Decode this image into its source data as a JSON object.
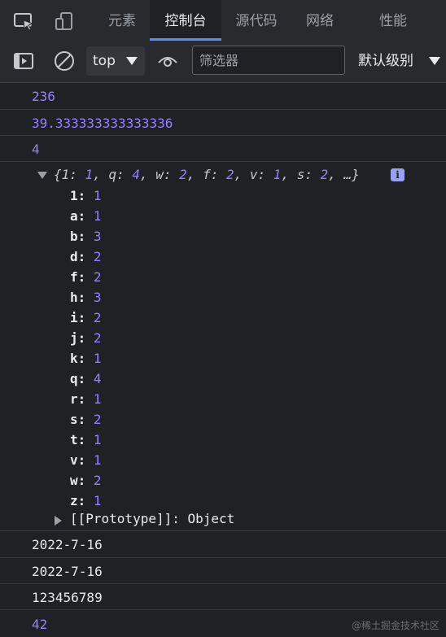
{
  "tabs": [
    {
      "label": "元素",
      "active": false
    },
    {
      "label": "控制台",
      "active": true
    },
    {
      "label": "源代码",
      "active": false
    },
    {
      "label": "网络",
      "active": false
    },
    {
      "label": "性能",
      "active": false
    }
  ],
  "toolbar": {
    "context": "top",
    "filter_placeholder": "筛选器",
    "filter_value": "",
    "levels": "默认级别"
  },
  "console": {
    "lines_before": [
      "236",
      "39.333333333333336",
      "4"
    ],
    "object": {
      "preview_open": "{",
      "preview_pairs": [
        {
          "k": "1",
          "v": "1"
        },
        {
          "k": "q",
          "v": "4"
        },
        {
          "k": "w",
          "v": "2"
        },
        {
          "k": "f",
          "v": "2"
        },
        {
          "k": "v",
          "v": "1"
        },
        {
          "k": "s",
          "v": "2"
        }
      ],
      "preview_close": ", …}",
      "info": "i",
      "properties": [
        {
          "k": "1",
          "v": "1"
        },
        {
          "k": "a",
          "v": "1"
        },
        {
          "k": "b",
          "v": "3"
        },
        {
          "k": "d",
          "v": "2"
        },
        {
          "k": "f",
          "v": "2"
        },
        {
          "k": "h",
          "v": "3"
        },
        {
          "k": "i",
          "v": "2"
        },
        {
          "k": "j",
          "v": "2"
        },
        {
          "k": "k",
          "v": "1"
        },
        {
          "k": "q",
          "v": "4"
        },
        {
          "k": "r",
          "v": "1"
        },
        {
          "k": "s",
          "v": "2"
        },
        {
          "k": "t",
          "v": "1"
        },
        {
          "k": "v",
          "v": "1"
        },
        {
          "k": "w",
          "v": "2"
        },
        {
          "k": "z",
          "v": "1"
        }
      ],
      "prototype": "[[Prototype]]: Object"
    },
    "lines_after": [
      "2022-7-16",
      "2022-7-16",
      "123456789",
      "42"
    ]
  },
  "watermark": "@稀土掘金技术社区",
  "colors": {
    "number": "#9980ff",
    "accent": "#4d90fe",
    "background": "#202124"
  }
}
